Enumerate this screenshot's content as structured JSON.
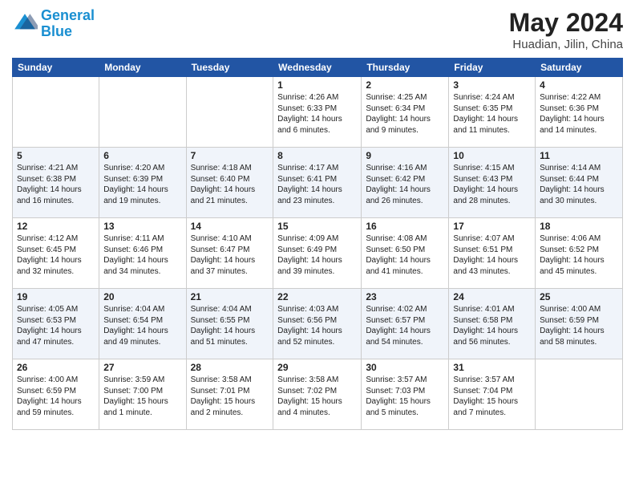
{
  "header": {
    "logo_line1": "General",
    "logo_line2": "Blue",
    "month_title": "May 2024",
    "location": "Huadian, Jilin, China"
  },
  "days_of_week": [
    "Sunday",
    "Monday",
    "Tuesday",
    "Wednesday",
    "Thursday",
    "Friday",
    "Saturday"
  ],
  "weeks": [
    [
      {
        "day": "",
        "info": ""
      },
      {
        "day": "",
        "info": ""
      },
      {
        "day": "",
        "info": ""
      },
      {
        "day": "1",
        "info": "Sunrise: 4:26 AM\nSunset: 6:33 PM\nDaylight: 14 hours\nand 6 minutes."
      },
      {
        "day": "2",
        "info": "Sunrise: 4:25 AM\nSunset: 6:34 PM\nDaylight: 14 hours\nand 9 minutes."
      },
      {
        "day": "3",
        "info": "Sunrise: 4:24 AM\nSunset: 6:35 PM\nDaylight: 14 hours\nand 11 minutes."
      },
      {
        "day": "4",
        "info": "Sunrise: 4:22 AM\nSunset: 6:36 PM\nDaylight: 14 hours\nand 14 minutes."
      }
    ],
    [
      {
        "day": "5",
        "info": "Sunrise: 4:21 AM\nSunset: 6:38 PM\nDaylight: 14 hours\nand 16 minutes."
      },
      {
        "day": "6",
        "info": "Sunrise: 4:20 AM\nSunset: 6:39 PM\nDaylight: 14 hours\nand 19 minutes."
      },
      {
        "day": "7",
        "info": "Sunrise: 4:18 AM\nSunset: 6:40 PM\nDaylight: 14 hours\nand 21 minutes."
      },
      {
        "day": "8",
        "info": "Sunrise: 4:17 AM\nSunset: 6:41 PM\nDaylight: 14 hours\nand 23 minutes."
      },
      {
        "day": "9",
        "info": "Sunrise: 4:16 AM\nSunset: 6:42 PM\nDaylight: 14 hours\nand 26 minutes."
      },
      {
        "day": "10",
        "info": "Sunrise: 4:15 AM\nSunset: 6:43 PM\nDaylight: 14 hours\nand 28 minutes."
      },
      {
        "day": "11",
        "info": "Sunrise: 4:14 AM\nSunset: 6:44 PM\nDaylight: 14 hours\nand 30 minutes."
      }
    ],
    [
      {
        "day": "12",
        "info": "Sunrise: 4:12 AM\nSunset: 6:45 PM\nDaylight: 14 hours\nand 32 minutes."
      },
      {
        "day": "13",
        "info": "Sunrise: 4:11 AM\nSunset: 6:46 PM\nDaylight: 14 hours\nand 34 minutes."
      },
      {
        "day": "14",
        "info": "Sunrise: 4:10 AM\nSunset: 6:47 PM\nDaylight: 14 hours\nand 37 minutes."
      },
      {
        "day": "15",
        "info": "Sunrise: 4:09 AM\nSunset: 6:49 PM\nDaylight: 14 hours\nand 39 minutes."
      },
      {
        "day": "16",
        "info": "Sunrise: 4:08 AM\nSunset: 6:50 PM\nDaylight: 14 hours\nand 41 minutes."
      },
      {
        "day": "17",
        "info": "Sunrise: 4:07 AM\nSunset: 6:51 PM\nDaylight: 14 hours\nand 43 minutes."
      },
      {
        "day": "18",
        "info": "Sunrise: 4:06 AM\nSunset: 6:52 PM\nDaylight: 14 hours\nand 45 minutes."
      }
    ],
    [
      {
        "day": "19",
        "info": "Sunrise: 4:05 AM\nSunset: 6:53 PM\nDaylight: 14 hours\nand 47 minutes."
      },
      {
        "day": "20",
        "info": "Sunrise: 4:04 AM\nSunset: 6:54 PM\nDaylight: 14 hours\nand 49 minutes."
      },
      {
        "day": "21",
        "info": "Sunrise: 4:04 AM\nSunset: 6:55 PM\nDaylight: 14 hours\nand 51 minutes."
      },
      {
        "day": "22",
        "info": "Sunrise: 4:03 AM\nSunset: 6:56 PM\nDaylight: 14 hours\nand 52 minutes."
      },
      {
        "day": "23",
        "info": "Sunrise: 4:02 AM\nSunset: 6:57 PM\nDaylight: 14 hours\nand 54 minutes."
      },
      {
        "day": "24",
        "info": "Sunrise: 4:01 AM\nSunset: 6:58 PM\nDaylight: 14 hours\nand 56 minutes."
      },
      {
        "day": "25",
        "info": "Sunrise: 4:00 AM\nSunset: 6:59 PM\nDaylight: 14 hours\nand 58 minutes."
      }
    ],
    [
      {
        "day": "26",
        "info": "Sunrise: 4:00 AM\nSunset: 6:59 PM\nDaylight: 14 hours\nand 59 minutes."
      },
      {
        "day": "27",
        "info": "Sunrise: 3:59 AM\nSunset: 7:00 PM\nDaylight: 15 hours\nand 1 minute."
      },
      {
        "day": "28",
        "info": "Sunrise: 3:58 AM\nSunset: 7:01 PM\nDaylight: 15 hours\nand 2 minutes."
      },
      {
        "day": "29",
        "info": "Sunrise: 3:58 AM\nSunset: 7:02 PM\nDaylight: 15 hours\nand 4 minutes."
      },
      {
        "day": "30",
        "info": "Sunrise: 3:57 AM\nSunset: 7:03 PM\nDaylight: 15 hours\nand 5 minutes."
      },
      {
        "day": "31",
        "info": "Sunrise: 3:57 AM\nSunset: 7:04 PM\nDaylight: 15 hours\nand 7 minutes."
      },
      {
        "day": "",
        "info": ""
      }
    ]
  ]
}
